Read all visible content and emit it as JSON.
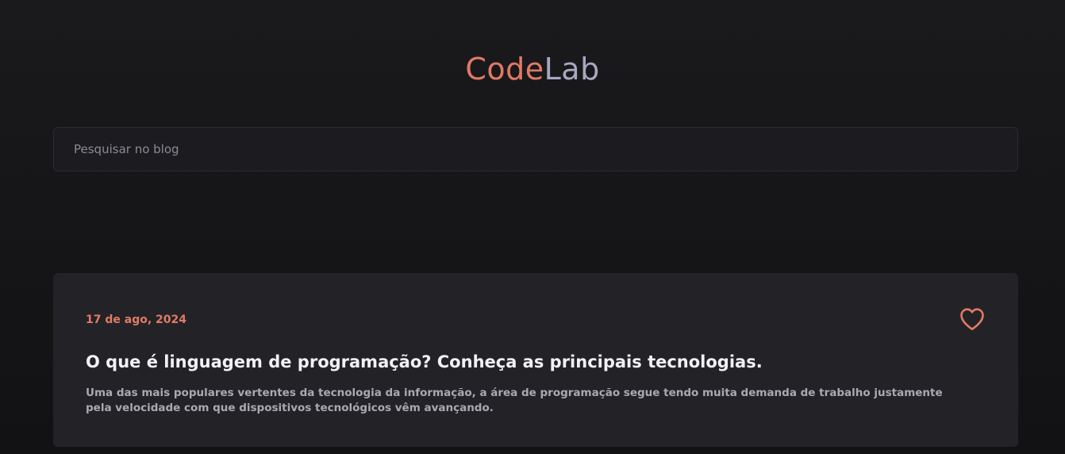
{
  "header": {
    "logo_part1": "Code",
    "logo_part2": "Lab"
  },
  "search": {
    "placeholder": "Pesquisar no blog",
    "value": ""
  },
  "posts": [
    {
      "date": "17 de ago, 2024",
      "title": "O que é linguagem de programação? Conheça as principais tecnologias.",
      "excerpt": "Uma das mais populares vertentes da tecnologia da informação, a área de programação segue tendo muita demanda de trabalho justamente pela velocidade com que dispositivos tecnológicos vêm avançando.",
      "icon": "heart-icon"
    }
  ],
  "colors": {
    "background": "#161618",
    "card": "#232327",
    "accent": "#e07a66",
    "logo_secondary": "#a7a8c0",
    "text_muted": "#a9a9b2"
  }
}
